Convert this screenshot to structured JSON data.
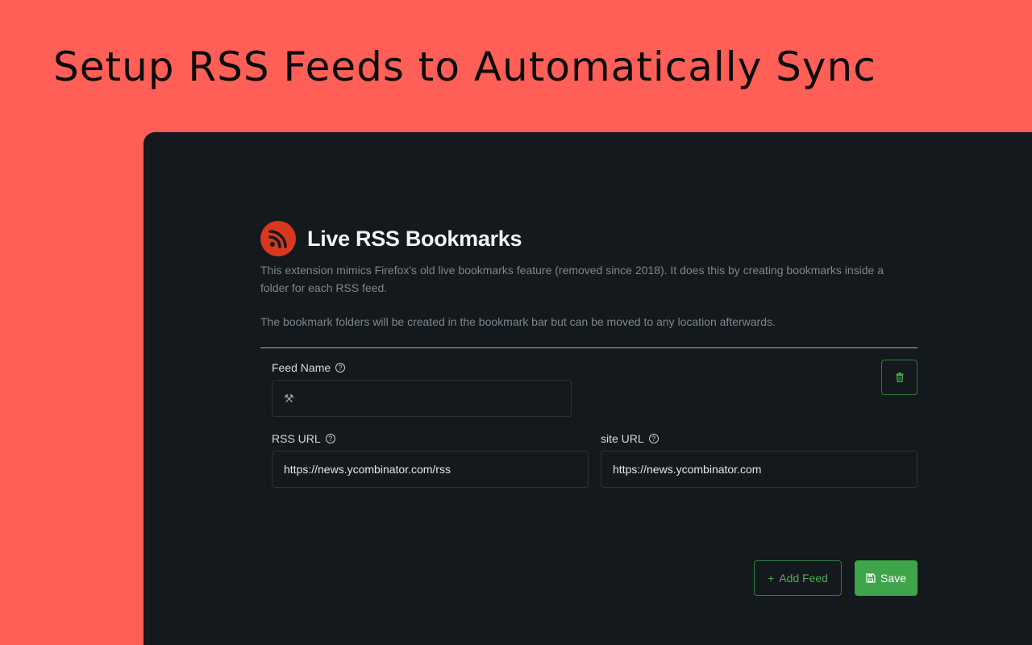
{
  "promo": {
    "title": "Setup RSS Feeds to Automatically Sync"
  },
  "app": {
    "title": "Live RSS Bookmarks",
    "description_1": "This extension mimics Firefox's old live bookmarks feature (removed since 2018). It does this by creating bookmarks inside a folder for each RSS feed.",
    "description_2": "The bookmark folders will be created in the bookmark bar but can be moved to any location afterwards."
  },
  "feed": {
    "name_label": "Feed Name",
    "name_value": "⚒",
    "rss_url_label": "RSS URL",
    "rss_url_value": "https://news.ycombinator.com/rss",
    "site_url_label": "site URL",
    "site_url_value": "https://news.ycombinator.com"
  },
  "actions": {
    "add_feed_label": "Add Feed",
    "save_label": "Save"
  },
  "icons": {
    "logo": "rss-icon",
    "help": "question-circle-icon",
    "delete": "trash-icon",
    "add": "plus-icon",
    "save": "floppy-disk-icon"
  },
  "colors": {
    "background": "#ff5f57",
    "panel": "#13191d",
    "accent": "#3ea54a",
    "logo": "#d9381e"
  }
}
